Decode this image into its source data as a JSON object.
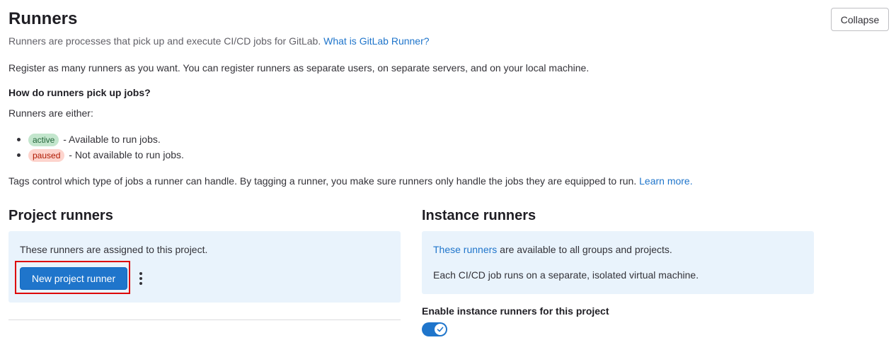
{
  "header": {
    "title": "Runners",
    "collapse_label": "Collapse",
    "subtitle_text": "Runners are processes that pick up and execute CI/CD jobs for GitLab.",
    "subtitle_link": "What is GitLab Runner?"
  },
  "intro": {
    "register_text": "Register as many runners as you want. You can register runners as separate users, on separate servers, and on your local machine.",
    "question": "How do runners pick up jobs?",
    "either_text": "Runners are either:"
  },
  "statuses": [
    {
      "badge": "active",
      "description": "- Available to run jobs.",
      "color": "#c3e6cd"
    },
    {
      "badge": "paused",
      "description": "- Not available to run jobs.",
      "color": "#fdd4cd"
    }
  ],
  "tags": {
    "text": "Tags control which type of jobs a runner can handle. By tagging a runner, you make sure runners only handle the jobs they are equipped to run.",
    "link": "Learn more."
  },
  "project_runners": {
    "title": "Project runners",
    "description": "These runners are assigned to this project.",
    "new_button_label": "New project runner",
    "menu_icon": "ellipsis-v-icon"
  },
  "instance_runners": {
    "title": "Instance runners",
    "link_text": "These runners",
    "availability_text": "are available to all groups and projects.",
    "isolation_text": "Each CI/CD job runs on a separate, isolated virtual machine.",
    "toggle_label": "Enable instance runners for this project",
    "toggle_enabled": true
  },
  "colors": {
    "accent": "#1f75cb",
    "info_background": "#e9f3fc",
    "highlight": "#dd0000"
  }
}
